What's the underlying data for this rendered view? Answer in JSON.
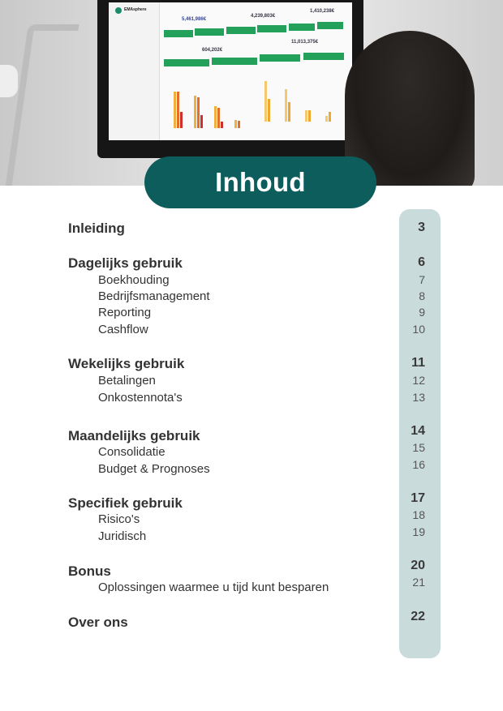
{
  "header": {
    "title": "Inhoud"
  },
  "toc": [
    {
      "label": "Inleiding",
      "page": "3",
      "level": "main"
    },
    {
      "label": "Dagelijks gebruik",
      "page": "6",
      "level": "main"
    },
    {
      "label": "Boekhouding",
      "page": "7",
      "level": "sub"
    },
    {
      "label": "Bedrijfsmanagement",
      "page": "8",
      "level": "sub"
    },
    {
      "label": "Reporting",
      "page": "9",
      "level": "sub"
    },
    {
      "label": "Cashflow",
      "page": "10",
      "level": "sub"
    },
    {
      "label": "Wekelijks gebruik",
      "page": "11",
      "level": "main"
    },
    {
      "label": "Betalingen",
      "page": "12",
      "level": "sub"
    },
    {
      "label": "Onkostennota's",
      "page": "13",
      "level": "sub"
    },
    {
      "label": "Maandelijks gebruik",
      "page": "14",
      "level": "main"
    },
    {
      "label": "Consolidatie",
      "page": "15",
      "level": "sub"
    },
    {
      "label": "Budget & Prognoses",
      "page": "16",
      "level": "sub"
    },
    {
      "label": "Specifiek gebruik",
      "page": "17",
      "level": "main"
    },
    {
      "label": "Risico's",
      "page": "18",
      "level": "sub"
    },
    {
      "label": "Juridisch",
      "page": "19",
      "level": "sub"
    },
    {
      "label": "Bonus",
      "page": "20",
      "level": "main"
    },
    {
      "label": "Oplossingen waarmee u tijd kunt besparen",
      "page": "21",
      "level": "sub"
    },
    {
      "label": "Over ons",
      "page": "22",
      "level": "main"
    }
  ],
  "photo": {
    "app_name": "EMAsphere",
    "kpis": [
      "5,461,986€",
      "4,239,803€",
      "1,410,238€",
      "604,202€",
      "11,013,375€"
    ]
  },
  "colors": {
    "banner": "#0c5d5b",
    "page_column": "#c9dcdb",
    "text": "#333333"
  }
}
